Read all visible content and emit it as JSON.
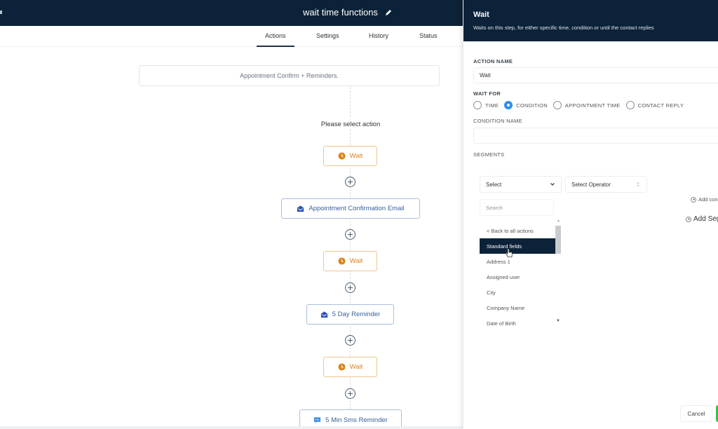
{
  "header": {
    "workflow_title": "wait time functions",
    "tabs": [
      {
        "label": "Actions",
        "active": true
      },
      {
        "label": "Settings",
        "active": false
      },
      {
        "label": "History",
        "active": false
      },
      {
        "label": "Status",
        "active": false
      }
    ]
  },
  "canvas": {
    "trigger_label": "Appointment Confirm + Reminders.",
    "select_action_label": "Please select action",
    "nodes": [
      {
        "type": "wait",
        "label": "Wait",
        "icon": "clock-icon"
      },
      {
        "type": "email",
        "label": "Appointment Confirmation Email",
        "icon": "email-icon"
      },
      {
        "type": "wait",
        "label": "Wait",
        "icon": "clock-icon"
      },
      {
        "type": "email",
        "label": "5 Day Reminder",
        "icon": "email-icon"
      },
      {
        "type": "wait",
        "label": "Wait",
        "icon": "clock-icon"
      },
      {
        "type": "sms",
        "label": "5 Min Sms Reminder",
        "icon": "sms-icon"
      }
    ]
  },
  "panel": {
    "title": "Wait",
    "subtitle": "Waits on this step, for either specific time, condition or until the contact replies",
    "action_name_label": "ACTION NAME",
    "action_name_value": "Wait",
    "wait_for_label": "WAIT FOR",
    "wait_for_options": [
      {
        "label": "TIME",
        "checked": false
      },
      {
        "label": "CONDITION",
        "checked": true
      },
      {
        "label": "APPOINTMENT TIME",
        "checked": false
      },
      {
        "label": "CONTACT REPLY",
        "checked": false
      }
    ],
    "condition_name_label": "CONDITION NAME",
    "condition_name_value": "",
    "segments_label": "SEGMENTS",
    "field_select": "Select",
    "operator_select": "Select Operator",
    "dropdown": {
      "search_placeholder": "Search",
      "back_label": "< Back to all actions",
      "group_header": "Standard fields",
      "items": [
        "Address 1",
        "Assigned user",
        "City",
        "Company Name",
        "Date of Birth"
      ]
    },
    "add_condition_label": "Add con",
    "add_segment_label": "Add Seg",
    "cancel_label": "Cancel"
  },
  "colors": {
    "header_bg": "#0c2238",
    "wait_accent": "#d9851f",
    "email_accent": "#3a5f9a",
    "radio_checked": "#2d8ff0",
    "save_green": "#37c142"
  }
}
